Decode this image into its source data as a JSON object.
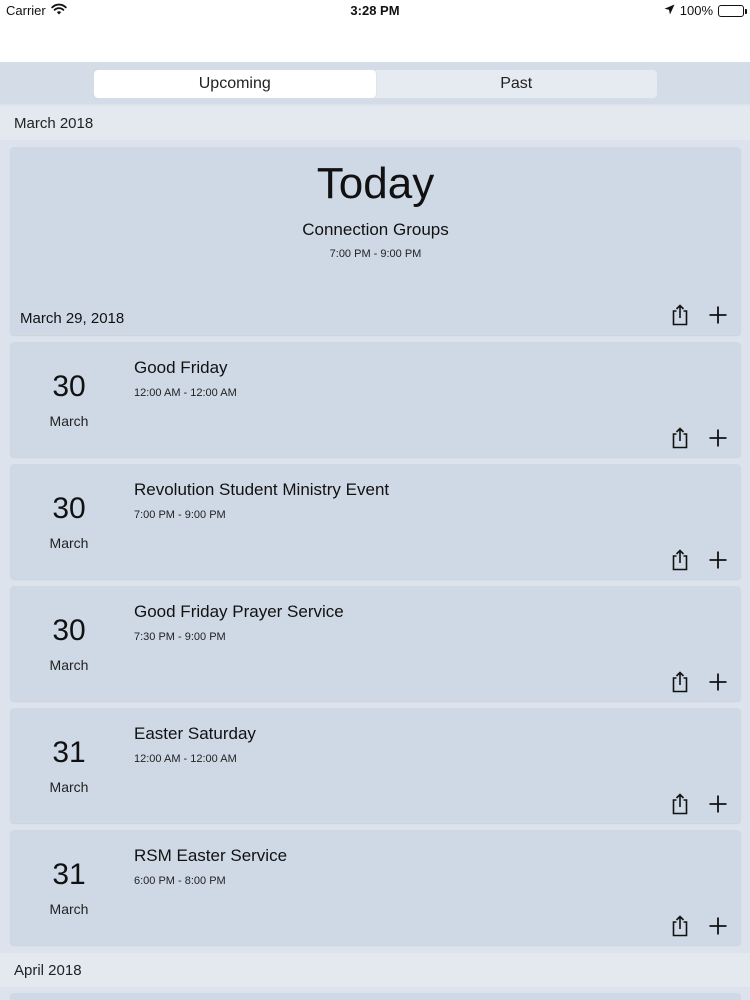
{
  "status_bar": {
    "carrier": "Carrier",
    "time": "3:28 PM",
    "battery": "100%"
  },
  "tabs": [
    {
      "label": "Upcoming",
      "active": true
    },
    {
      "label": "Past",
      "active": false
    }
  ],
  "sections": [
    {
      "header": "March 2018",
      "today": {
        "heading": "Today",
        "event": "Connection Groups",
        "time": "7:00 PM - 9:00 PM",
        "date": "March 29, 2018"
      },
      "events": [
        {
          "day": "30",
          "month": "March",
          "title": "Good Friday",
          "time": "12:00 AM - 12:00 AM"
        },
        {
          "day": "30",
          "month": "March",
          "title": "Revolution Student Ministry Event",
          "time": "7:00 PM - 9:00 PM"
        },
        {
          "day": "30",
          "month": "March",
          "title": "Good Friday Prayer Service",
          "time": "7:30 PM - 9:00 PM"
        },
        {
          "day": "31",
          "month": "March",
          "title": "Easter Saturday",
          "time": "12:00 AM - 12:00 AM"
        },
        {
          "day": "31",
          "month": "March",
          "title": "RSM Easter Service",
          "time": "6:00 PM - 8:00 PM"
        }
      ]
    },
    {
      "header": "April 2018"
    }
  ],
  "icons": {
    "share": "share-icon",
    "add": "plus-icon",
    "wifi": "wifi-icon",
    "location": "location-arrow-icon",
    "battery": "battery-icon"
  },
  "colors": {
    "card_bg": "#cfd9e6",
    "section_bg": "#e4e9f0",
    "page_bg": "#dde3ec"
  }
}
